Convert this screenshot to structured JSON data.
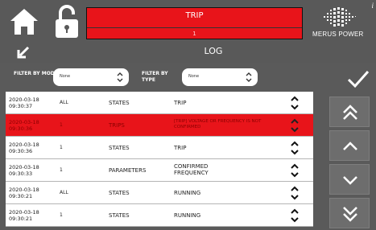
{
  "header": {
    "trip_title": "TRIP",
    "trip_subtitle": "1",
    "logo_text": "MERUS POWER",
    "info_label": "i"
  },
  "page": {
    "title": "LOG"
  },
  "filters": {
    "module_label": "FILTER BY MODULE",
    "module_value": "None",
    "type_label": "FILTER BY TYPE",
    "type_value": "None"
  },
  "log_rows": [
    {
      "date": "2020-03-18",
      "time": "09:30:37",
      "module": "ALL",
      "category": "STATES",
      "message": "TRIP",
      "highlight": false
    },
    {
      "date": "2020-03-18",
      "time": "09:30:36",
      "module": "1",
      "category": "TRIPS",
      "message": "[TRIP] VOLTAGE OR FREQUENCY IS NOT CONFIRMED",
      "highlight": true
    },
    {
      "date": "2020-03-18",
      "time": "09:30:36",
      "module": "1",
      "category": "STATES",
      "message": "TRIP",
      "highlight": false
    },
    {
      "date": "2020-03-18",
      "time": "09:30:33",
      "module": "1",
      "category": "PARAMETERS",
      "message": "CONFIRMED FREQUENCY",
      "highlight": false
    },
    {
      "date": "2020-03-18",
      "time": "09:30:21",
      "module": "ALL",
      "category": "STATES",
      "message": "RUNNING",
      "highlight": false
    },
    {
      "date": "2020-03-18",
      "time": "09:30:21",
      "module": "1",
      "category": "STATES",
      "message": "RUNNING",
      "highlight": false
    }
  ],
  "colors": {
    "background": "#5a5a5a",
    "trip_red": "#e8141a",
    "row_bg": "#ffffff",
    "button_bg": "#6d6d6d"
  },
  "icons": {
    "home": "home-icon",
    "lock": "unlock-icon",
    "back": "arrow-down-left-icon",
    "confirm": "checkmark-icon",
    "scroll_top": "double-chevron-up-icon",
    "scroll_up": "chevron-up-icon",
    "scroll_down": "chevron-down-icon",
    "scroll_bottom": "double-chevron-down-icon"
  }
}
